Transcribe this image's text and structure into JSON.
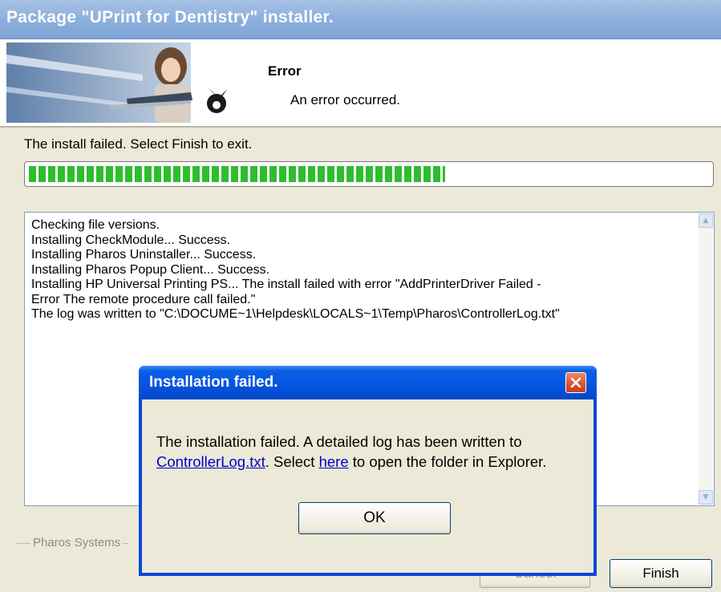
{
  "window": {
    "title": "Package \"UPrint for Dentistry\" installer."
  },
  "banner": {
    "heading": "Error",
    "subtext": "An error occurred."
  },
  "status": {
    "text": "The install failed. Select Finish to exit.",
    "progress_fraction": 0.61,
    "progress_color": "#2fbd2f"
  },
  "log": {
    "lines": [
      "Checking file versions.",
      "Installing CheckModule... Success.",
      "Installing Pharos Uninstaller... Success.",
      "Installing Pharos Popup Client... Success.",
      "Installing HP Universal Printing PS... The install failed with error \"AddPrinterDriver Failed -",
      "Error The remote procedure call failed.\"",
      "The log was written to \"C:\\DOCUME~1\\Helpdesk\\LOCALS~1\\Temp\\Pharos\\ControllerLog.txt\""
    ]
  },
  "footer": {
    "group_label": "Pharos Systems",
    "cancel_label": "Cancel",
    "finish_label": "Finish"
  },
  "dialog": {
    "title": "Installation failed.",
    "msg_part1": "The installation failed. A detailed log has been written to ",
    "log_link": "ControllerLog.txt",
    "msg_part2": ". Select ",
    "here_link": "here",
    "msg_part3": " to open the folder in Explorer.",
    "ok_label": "OK"
  },
  "colors": {
    "titlebar": "#7ea4d6",
    "dialog_titlebar": "#0554e0",
    "close_button": "#d8512c",
    "link": "#0000cc"
  },
  "icons": [
    "close-icon",
    "scroll-up-icon",
    "scroll-down-icon"
  ]
}
